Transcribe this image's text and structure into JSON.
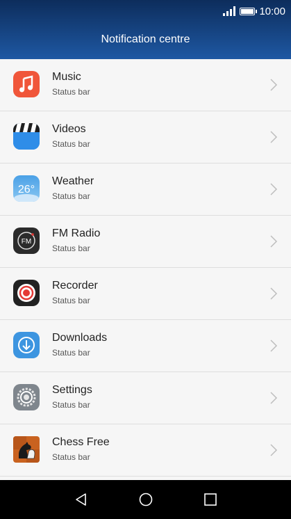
{
  "status_bar": {
    "time": "10:00"
  },
  "header": {
    "title": "Notification centre"
  },
  "apps": [
    {
      "name": "Music",
      "subtitle": "Status bar",
      "icon": "music-icon",
      "color": "#f0563a"
    },
    {
      "name": "Videos",
      "subtitle": "Status bar",
      "icon": "videos-icon",
      "color": "#2f8de8"
    },
    {
      "name": "Weather",
      "subtitle": "Status bar",
      "icon": "weather-icon",
      "icon_text": "26°",
      "color": "#4aa0e6"
    },
    {
      "name": "FM Radio",
      "subtitle": "Status bar",
      "icon": "fm-radio-icon",
      "icon_text": "FM",
      "color": "#2b2b2b"
    },
    {
      "name": "Recorder",
      "subtitle": "Status bar",
      "icon": "recorder-icon",
      "color": "#222222"
    },
    {
      "name": "Downloads",
      "subtitle": "Status bar",
      "icon": "downloads-icon",
      "color": "#3d95e0"
    },
    {
      "name": "Settings",
      "subtitle": "Status bar",
      "icon": "settings-icon",
      "color": "#7f868d"
    },
    {
      "name": "Chess Free",
      "subtitle": "Status bar",
      "icon": "chess-icon",
      "color": "#c9621f"
    }
  ],
  "nav": {
    "back": "back-icon",
    "home": "home-icon",
    "recents": "recents-icon"
  }
}
